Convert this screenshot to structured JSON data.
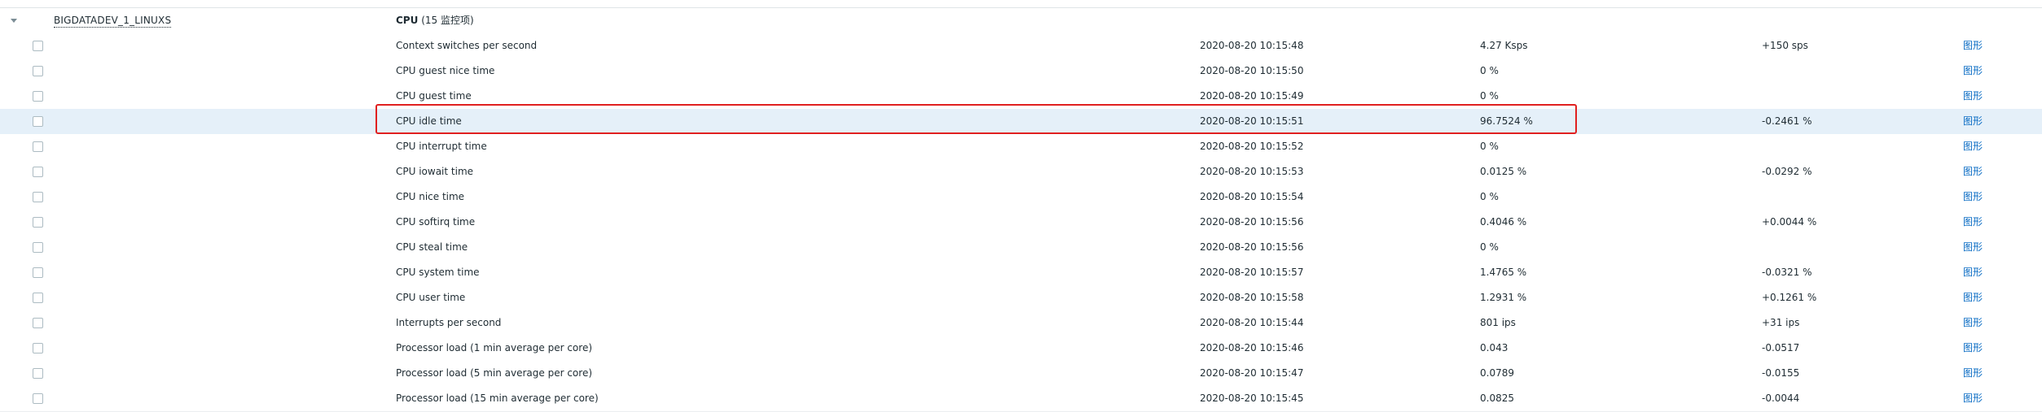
{
  "group": {
    "host": "BIGDATADEV_1_LINUXS",
    "app_name": "CPU",
    "item_count": "(15 监控项)"
  },
  "items": [
    {
      "name": "Context switches per second",
      "last_check": "2020-08-20 10:15:48",
      "last_value": "4.27 Ksps",
      "change": "+150 sps",
      "action": "图形"
    },
    {
      "name": "CPU guest nice time",
      "last_check": "2020-08-20 10:15:50",
      "last_value": "0 %",
      "change": "",
      "action": "图形"
    },
    {
      "name": "CPU guest time",
      "last_check": "2020-08-20 10:15:49",
      "last_value": "0 %",
      "change": "",
      "action": "图形"
    },
    {
      "name": "CPU idle time",
      "last_check": "2020-08-20 10:15:51",
      "last_value": "96.7524 %",
      "change": "-0.2461 %",
      "action": "图形"
    },
    {
      "name": "CPU interrupt time",
      "last_check": "2020-08-20 10:15:52",
      "last_value": "0 %",
      "change": "",
      "action": "图形"
    },
    {
      "name": "CPU iowait time",
      "last_check": "2020-08-20 10:15:53",
      "last_value": "0.0125 %",
      "change": "-0.0292 %",
      "action": "图形"
    },
    {
      "name": "CPU nice time",
      "last_check": "2020-08-20 10:15:54",
      "last_value": "0 %",
      "change": "",
      "action": "图形"
    },
    {
      "name": "CPU softirq time",
      "last_check": "2020-08-20 10:15:56",
      "last_value": "0.4046 %",
      "change": "+0.0044 %",
      "action": "图形"
    },
    {
      "name": "CPU steal time",
      "last_check": "2020-08-20 10:15:56",
      "last_value": "0 %",
      "change": "",
      "action": "图形"
    },
    {
      "name": "CPU system time",
      "last_check": "2020-08-20 10:15:57",
      "last_value": "1.4765 %",
      "change": "-0.0321 %",
      "action": "图形"
    },
    {
      "name": "CPU user time",
      "last_check": "2020-08-20 10:15:58",
      "last_value": "1.2931 %",
      "change": "+0.1261 %",
      "action": "图形"
    },
    {
      "name": "Interrupts per second",
      "last_check": "2020-08-20 10:15:44",
      "last_value": "801 ips",
      "change": "+31 ips",
      "action": "图形"
    },
    {
      "name": "Processor load (1 min average per core)",
      "last_check": "2020-08-20 10:15:46",
      "last_value": "0.043",
      "change": "-0.0517",
      "action": "图形"
    },
    {
      "name": "Processor load (5 min average per core)",
      "last_check": "2020-08-20 10:15:47",
      "last_value": "0.0789",
      "change": "-0.0155",
      "action": "图形"
    },
    {
      "name": "Processor load (15 min average per core)",
      "last_check": "2020-08-20 10:15:45",
      "last_value": "0.0825",
      "change": "-0.0044",
      "action": "图形"
    }
  ],
  "highlighted_item": "CPU idle time",
  "colors": {
    "highlight_row": "#e5f0f9",
    "annotation_box": "#e02020",
    "link": "#0a6cc4"
  }
}
